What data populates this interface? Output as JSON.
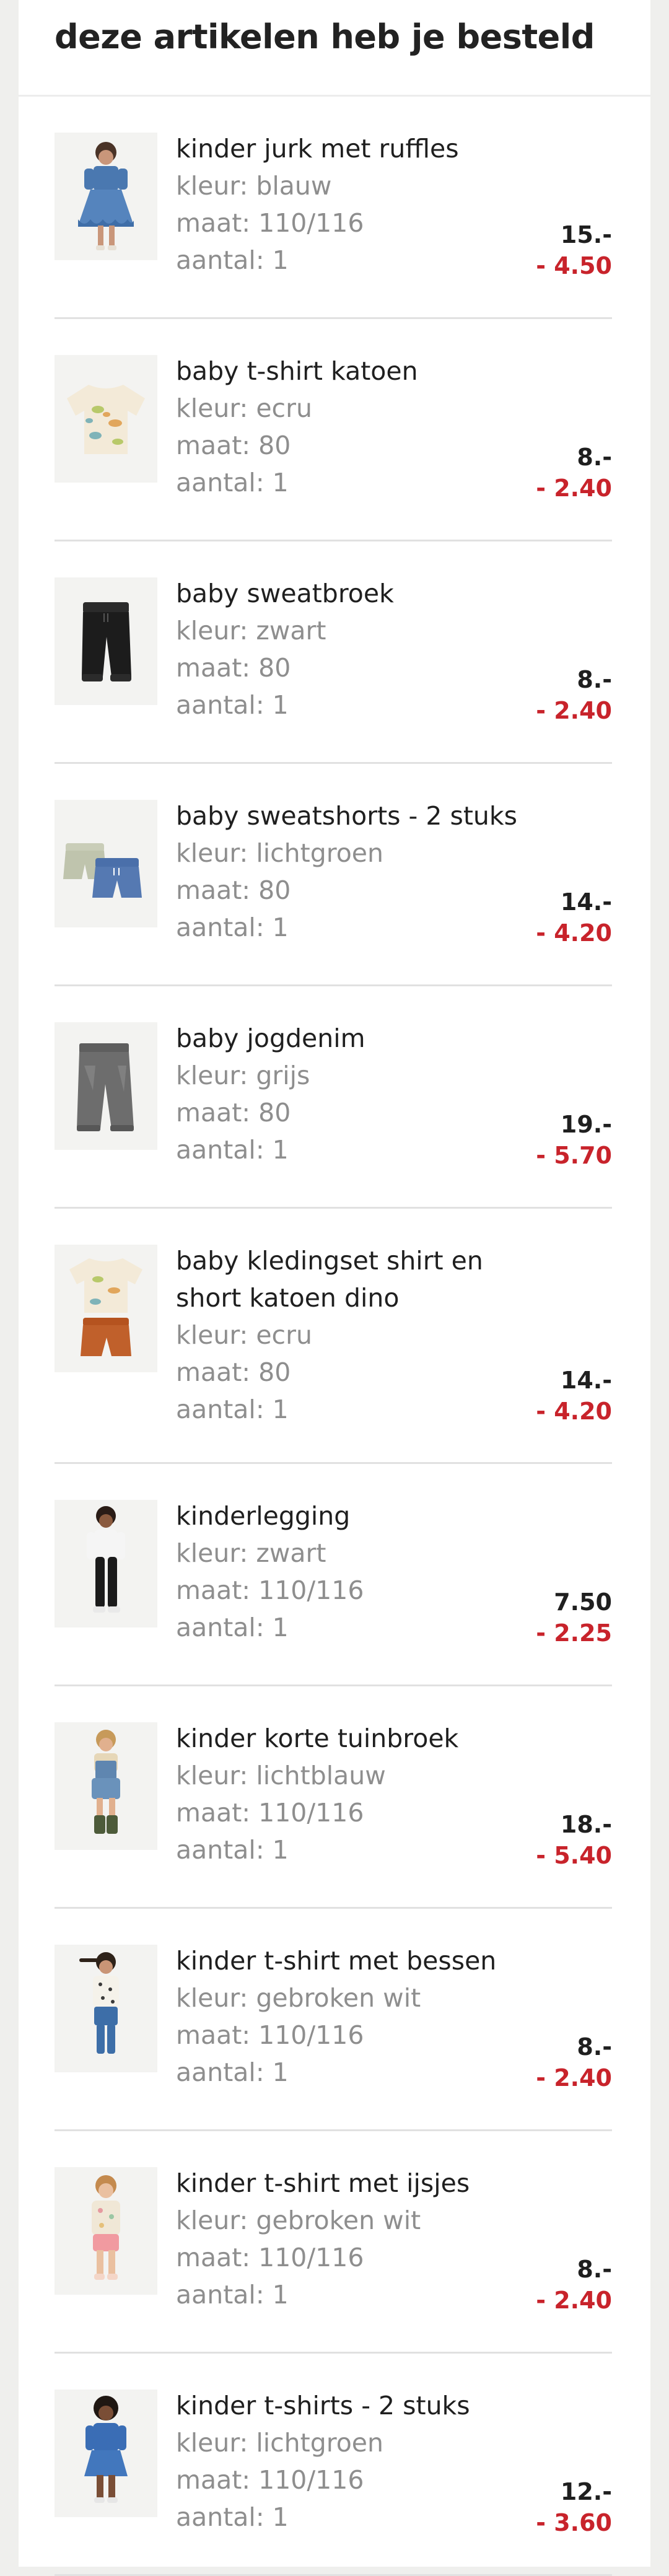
{
  "order": {
    "title": "deze artikelen heb je besteld",
    "items": [
      {
        "name": "kinder jurk met ruffles",
        "color": "kleur: blauw",
        "size": "maat: 110/116",
        "quantity": "aantal: 1",
        "price": "15.-",
        "discount": "- 4.50",
        "image": "girl-blue-ruffle-dress-photo"
      },
      {
        "name": "baby t-shirt katoen",
        "color": "kleur: ecru",
        "size": "maat: 80",
        "quantity": "aantal: 1",
        "price": "8.-",
        "discount": "- 2.40",
        "image": "ecru-dino-tshirt-photo"
      },
      {
        "name": "baby sweatbroek",
        "color": "kleur: zwart",
        "size": "maat: 80",
        "quantity": "aantal: 1",
        "price": "8.-",
        "discount": "- 2.40",
        "image": "black-sweatpants-photo"
      },
      {
        "name": "baby sweatshorts - 2 stuks",
        "color": "kleur: lichtgroen",
        "size": "maat: 80",
        "quantity": "aantal: 1",
        "price": "14.-",
        "discount": "- 4.20",
        "image": "two-sweatshorts-photo"
      },
      {
        "name": "baby jogdenim",
        "color": "kleur: grijs",
        "size": "maat: 80",
        "quantity": "aantal: 1",
        "price": "19.-",
        "discount": "- 5.70",
        "image": "grey-jeans-photo"
      },
      {
        "name": "baby kledingset shirt en short katoen dino",
        "color": "kleur: ecru",
        "size": "maat: 80",
        "quantity": "aantal: 1",
        "price": "14.-",
        "discount": "- 4.20",
        "image": "dino-shirt-and-short-set-photo"
      },
      {
        "name": "kinderlegging",
        "color": "kleur: zwart",
        "size": "maat: 110/116",
        "quantity": "aantal: 1",
        "price": "7.50",
        "discount": "- 2.25",
        "image": "girl-black-legging-photo"
      },
      {
        "name": "kinder korte tuinbroek",
        "color": "kleur: lichtblauw",
        "size": "maat: 110/116",
        "quantity": "aantal: 1",
        "price": "18.-",
        "discount": "- 5.40",
        "image": "girl-denim-overall-shorts-photo"
      },
      {
        "name": "kinder t-shirt met bessen",
        "color": "kleur: gebroken wit",
        "size": "maat: 110/116",
        "quantity": "aantal: 1",
        "price": "8.-",
        "discount": "- 2.40",
        "image": "girl-berry-tshirt-photo"
      },
      {
        "name": "kinder t-shirt met ijsjes",
        "color": "kleur: gebroken wit",
        "size": "maat: 110/116",
        "quantity": "aantal: 1",
        "price": "8.-",
        "discount": "- 2.40",
        "image": "girl-icecream-tshirt-photo"
      },
      {
        "name": "kinder t-shirts - 2 stuks",
        "color": "kleur: lichtgroen",
        "size": "maat: 110/116",
        "quantity": "aantal: 1",
        "price": "12.-",
        "discount": "- 3.60",
        "image": "girl-blue-tshirt-skirt-photo"
      }
    ]
  },
  "theme": {
    "page_background": "#efefed",
    "card_background": "#ffffff",
    "text_color": "#1f1f1f",
    "muted_color": "#8e8e8e",
    "discount_color": "#c8232b",
    "divider_color": "#e1e1e1"
  }
}
